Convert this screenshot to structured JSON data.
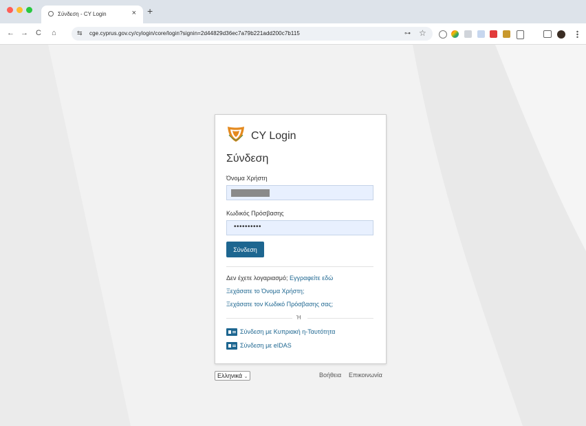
{
  "browser": {
    "tab_title": "Σύνδεση - CY Login",
    "tab_close": "×",
    "new_tab": "+",
    "url": "cge.cyprus.gov.cy/cylogin/core/login?signin=2d44829d36ec7a79b221add200c7b115",
    "nav_back": "←",
    "nav_forward": "→",
    "nav_reload": "C",
    "nav_home": "⌂",
    "site_settings": "⇆",
    "password_key": "⊶",
    "bookmark": "☆"
  },
  "login": {
    "brand": "CY Login",
    "heading": "Σύνδεση",
    "username_label": "Όνομα Χρήστη",
    "password_label": "Κωδικός Πρόσβασης",
    "password_value": "••••••••••",
    "submit_label": "Σύνδεση",
    "no_account": "Δεν έχετε λογαριασμό;",
    "register_link": "Εγγραφείτε εδώ",
    "forgot_username": "Ξεχάσατε το Όνομα Χρήστη;",
    "forgot_password": "Ξεχάσατε τον Κωδικό Πρόσβασης σας;",
    "or": "Ή",
    "cyprus_id": "Σύνδεση με Κυπριακή η-Ταυτότητα",
    "eidas": "Σύνδεση με eIDAS"
  },
  "footer": {
    "language": "Ελληνικά",
    "help": "Βοήθεια",
    "contact": "Επικοινωνία"
  },
  "colors": {
    "accent": "#1d6690",
    "input_bg": "#e8f0fe",
    "logo_orange": "#e48a1f"
  }
}
